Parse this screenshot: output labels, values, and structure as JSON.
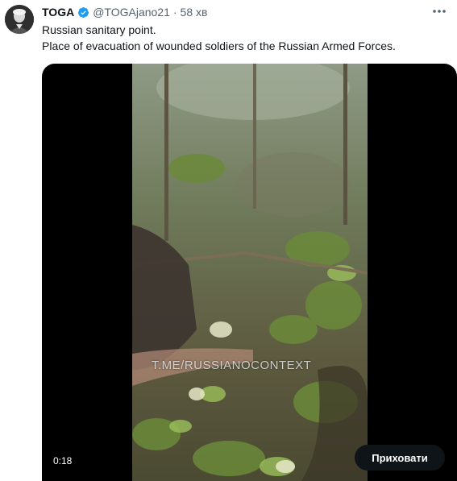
{
  "tweet": {
    "display_name": "TOGA",
    "handle": "@TOGAjano21",
    "separator": "·",
    "time": "58 хв",
    "text_lines": [
      "Russian sanitary point.",
      "Place of evacuation of wounded soldiers of the Russian Armed Forces."
    ],
    "verified_color": "#1d9bf0"
  },
  "media": {
    "watermark": "T.ME/RUSSIANOCONTEXT",
    "duration": "0:18",
    "hide_button_label": "Приховати"
  }
}
